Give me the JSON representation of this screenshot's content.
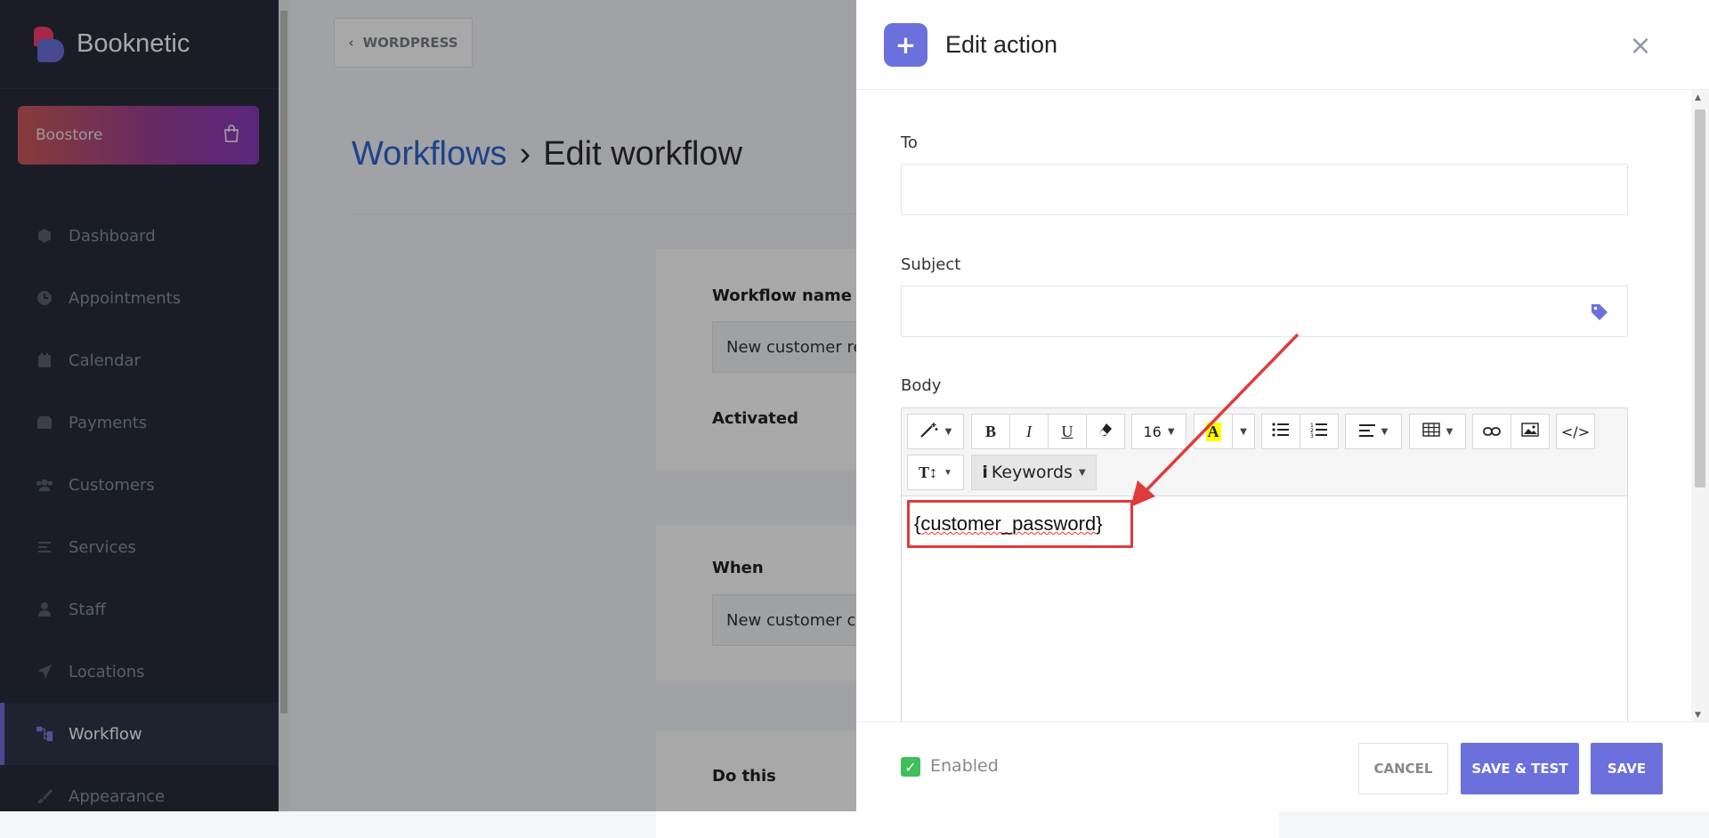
{
  "app": {
    "name": "Booknetic"
  },
  "sidebar": {
    "boostore": "Boostore",
    "items": [
      {
        "label": "Dashboard",
        "icon": "cube-icon",
        "active": false
      },
      {
        "label": "Appointments",
        "icon": "clock-icon",
        "active": false
      },
      {
        "label": "Calendar",
        "icon": "calendar-icon",
        "active": false
      },
      {
        "label": "Payments",
        "icon": "wallet-icon",
        "active": false
      },
      {
        "label": "Customers",
        "icon": "users-icon",
        "active": false
      },
      {
        "label": "Services",
        "icon": "list-icon",
        "active": false
      },
      {
        "label": "Staff",
        "icon": "user-icon",
        "active": false
      },
      {
        "label": "Locations",
        "icon": "location-arrow-icon",
        "active": false
      },
      {
        "label": "Workflow",
        "icon": "workflow-icon",
        "active": true
      },
      {
        "label": "Appearance",
        "icon": "brush-icon",
        "active": false
      }
    ]
  },
  "header": {
    "back_label": "WORDPRESS"
  },
  "page": {
    "breadcrumb": "Workflows",
    "separator": "›",
    "title": "Edit workflow",
    "workflow_name_label": "Workflow name",
    "workflow_name_value": "New customer re",
    "activated_label": "Activated",
    "when_label": "When",
    "when_value": "New customer cr",
    "do_this_label": "Do this"
  },
  "panel": {
    "title": "Edit action",
    "to_label": "To",
    "subject_label": "Subject",
    "body_label": "Body",
    "font_size": "16",
    "keywords_label": "Keywords",
    "body_text_open": "{",
    "body_text_word": "customer_password",
    "body_text_close": "}",
    "enabled_label": "Enabled",
    "cancel_label": "CANCEL",
    "save_test_label": "SAVE & TEST",
    "save_label": "SAVE"
  },
  "colors": {
    "accent": "#6c70dc",
    "annotation": "#e03b3b",
    "link": "#2a67d5",
    "enabled": "#3fbe5a"
  }
}
